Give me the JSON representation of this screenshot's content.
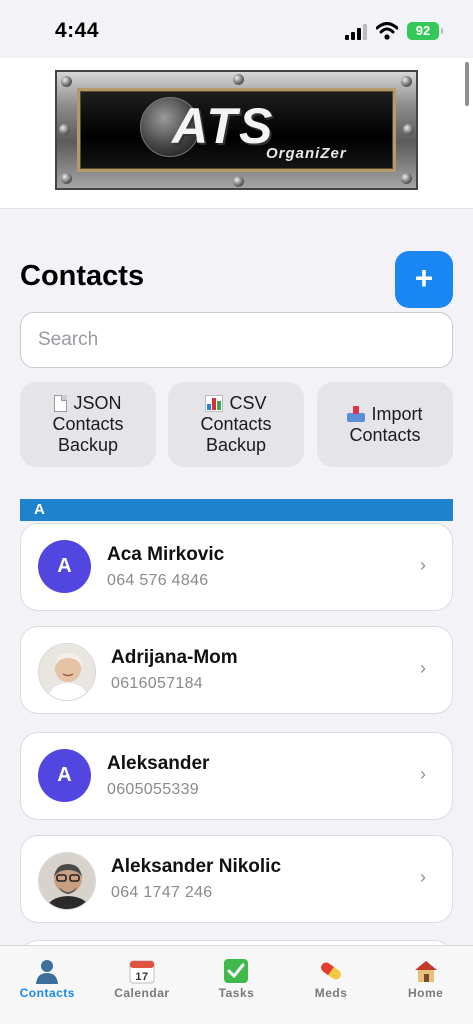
{
  "status_bar": {
    "time": "4:44",
    "battery": "92"
  },
  "header": {
    "logo_text": "ATS",
    "logo_subtext": "OrganiZer"
  },
  "page": {
    "title": "Contacts",
    "add_label": "+"
  },
  "search": {
    "placeholder": "Search",
    "value": ""
  },
  "actions": [
    {
      "line1": "JSON",
      "line2": "Contacts",
      "line3": "Backup",
      "icon": "document-icon"
    },
    {
      "line1": "CSV",
      "line2": "Contacts",
      "line3": "Backup",
      "icon": "bar-chart-icon"
    },
    {
      "line1": "Import",
      "line2": "Contacts",
      "icon": "inbox-tray-icon"
    }
  ],
  "section": {
    "letter": "A"
  },
  "contacts": [
    {
      "name": "Aca Mirkovic",
      "phone": "064 576 4846",
      "initial": "A",
      "avatar": "initial"
    },
    {
      "name": "Adrijana-Mom",
      "phone": "0616057184",
      "avatar": "photo"
    },
    {
      "name": "Aleksander",
      "phone": "0605055339",
      "initial": "A",
      "avatar": "initial"
    },
    {
      "name": "Aleksander Nikolic",
      "phone": "064 1747 246",
      "avatar": "photo"
    }
  ],
  "tabs": [
    {
      "label": "Contacts",
      "icon": "person-icon",
      "active": true
    },
    {
      "label": "Calendar",
      "icon": "calendar-icon",
      "calendar_day": "17",
      "active": false
    },
    {
      "label": "Tasks",
      "icon": "checkmark-icon",
      "active": false
    },
    {
      "label": "Meds",
      "icon": "pill-icon",
      "active": false
    },
    {
      "label": "Home",
      "icon": "house-icon",
      "active": false
    }
  ],
  "colors": {
    "accent": "#1a86f5",
    "avatar": "#5146e0",
    "section_header": "#1f82cf",
    "battery": "#34c759"
  }
}
